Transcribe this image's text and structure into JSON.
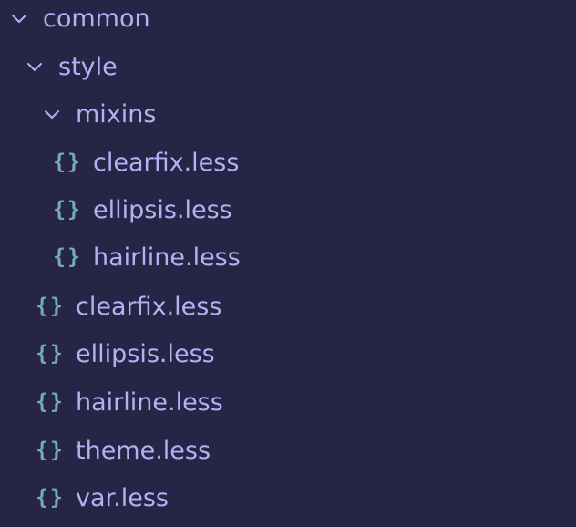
{
  "explorer": {
    "folders": [
      {
        "label": "common",
        "expanded": true,
        "icon": "chevron-down-icon"
      },
      {
        "label": "style",
        "expanded": true,
        "icon": "chevron-down-icon"
      },
      {
        "label": "mixins",
        "expanded": true,
        "icon": "chevron-down-icon"
      }
    ],
    "mixins_files": [
      {
        "label": "clearfix.less",
        "icon": "less-file-icon",
        "icon_glyph": "{}"
      },
      {
        "label": "ellipsis.less",
        "icon": "less-file-icon",
        "icon_glyph": "{}"
      },
      {
        "label": "hairline.less",
        "icon": "less-file-icon",
        "icon_glyph": "{}"
      }
    ],
    "style_files": [
      {
        "label": "clearfix.less",
        "icon": "less-file-icon",
        "icon_glyph": "{}"
      },
      {
        "label": "ellipsis.less",
        "icon": "less-file-icon",
        "icon_glyph": "{}"
      },
      {
        "label": "hairline.less",
        "icon": "less-file-icon",
        "icon_glyph": "{}"
      },
      {
        "label": "theme.less",
        "icon": "less-file-icon",
        "icon_glyph": "{}"
      },
      {
        "label": "var.less",
        "icon": "less-file-icon",
        "icon_glyph": "{}"
      }
    ],
    "colors": {
      "background": "#262545",
      "label": "#b4b0f3",
      "file_icon": "#74a9c1",
      "chevron": "#b4b0f3"
    }
  }
}
